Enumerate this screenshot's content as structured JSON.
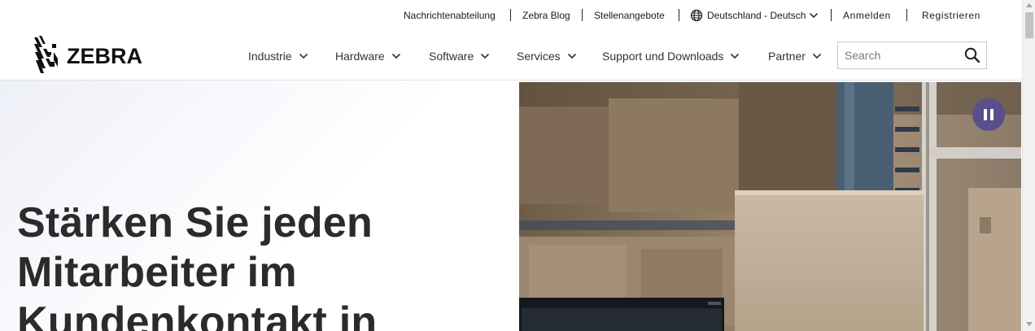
{
  "utility_nav": {
    "newsroom": "Nachrichtenabteilung",
    "blog": "Zebra Blog",
    "jobs": "Stellenangebote",
    "locale": "Deutschland - Deutsch",
    "login": "Anmelden",
    "register": "Registrieren"
  },
  "logo": {
    "text": "ZEBRA"
  },
  "main_nav": {
    "items": [
      {
        "label": "Industrie"
      },
      {
        "label": "Hardware"
      },
      {
        "label": "Software"
      },
      {
        "label": "Services"
      },
      {
        "label": "Support und Downloads"
      },
      {
        "label": "Partner"
      }
    ]
  },
  "search": {
    "placeholder": "Search",
    "value": ""
  },
  "hero": {
    "title_lines": [
      "Stärken Sie jeden",
      "Mitarbeiter im",
      "Kundenkontakt in"
    ]
  },
  "colors": {
    "pause_button": "#5b4e8c",
    "text": "#2b2b2b"
  }
}
